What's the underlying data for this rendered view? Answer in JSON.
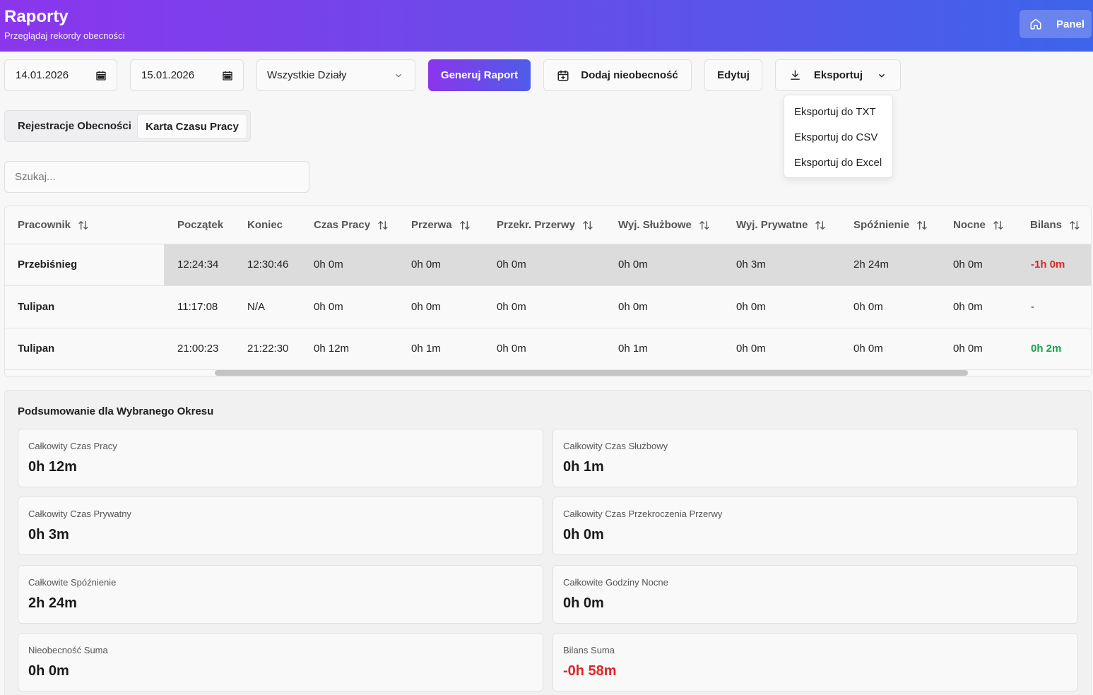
{
  "header": {
    "title": "Raporty",
    "subtitle": "Przeglądaj rekordy obecności",
    "panel_label": "Panel"
  },
  "toolbar": {
    "date_from": "14.01.2026",
    "date_to": "15.01.2026",
    "department": "Wszystkie Działy",
    "generate_label": "Generuj Raport",
    "add_absence_label": "Dodaj nieobecność",
    "edit_label": "Edytuj",
    "export_label": "Eksportuj"
  },
  "export_menu": {
    "items": [
      "Eksportuj do TXT",
      "Eksportuj do CSV",
      "Eksportuj do Excel"
    ]
  },
  "tabs": {
    "attendance": "Rejestracje Obecności",
    "timesheet": "Karta Czasu Pracy"
  },
  "search": {
    "placeholder": "Szukaj..."
  },
  "table": {
    "columns": [
      "Pracownik",
      "Początek",
      "Koniec",
      "Czas Pracy",
      "Przerwa",
      "Przekr. Przerwy",
      "Wyj. Służbowe",
      "Wyj. Prywatne",
      "Spóźnienie",
      "Nocne",
      "Bilans"
    ],
    "rows": [
      [
        "Przebiśnieg",
        "12:24:34",
        "12:30:46",
        "0h 0m",
        "0h 0m",
        "0h 0m",
        "0h 0m",
        "0h 3m",
        "2h 24m",
        "0h 0m",
        "-1h 0m"
      ],
      [
        "Tulipan",
        "11:17:08",
        "N/A",
        "0h 0m",
        "0h 0m",
        "0h 0m",
        "0h 0m",
        "0h 0m",
        "0h 0m",
        "0h 0m",
        "-"
      ],
      [
        "Tulipan",
        "21:00:23",
        "21:22:30",
        "0h 12m",
        "0h 1m",
        "0h 0m",
        "0h 1m",
        "0h 0m",
        "0h 0m",
        "0h 0m",
        "0h 2m"
      ]
    ]
  },
  "summary": {
    "title": "Podsumowanie dla Wybranego Okresu",
    "cards": [
      {
        "label": "Całkowity Czas Pracy",
        "value": "0h 12m"
      },
      {
        "label": "Całkowity Czas Służbowy",
        "value": "0h 1m"
      },
      {
        "label": "Całkowity Czas Prywatny",
        "value": "0h 3m"
      },
      {
        "label": "Całkowity Czas Przekroczenia Przerwy",
        "value": "0h 0m"
      },
      {
        "label": "Całkowite Spóźnienie",
        "value": "2h 24m"
      },
      {
        "label": "Całkowite Godziny Nocne",
        "value": "0h 0m"
      },
      {
        "label": "Nieobecność Suma",
        "value": "0h 0m"
      },
      {
        "label": "Bilans Suma",
        "value": "-0h 58m"
      }
    ]
  },
  "colors": {
    "negative": "#dc2626",
    "positive": "#16a34a",
    "accent": "#7c3aed"
  }
}
